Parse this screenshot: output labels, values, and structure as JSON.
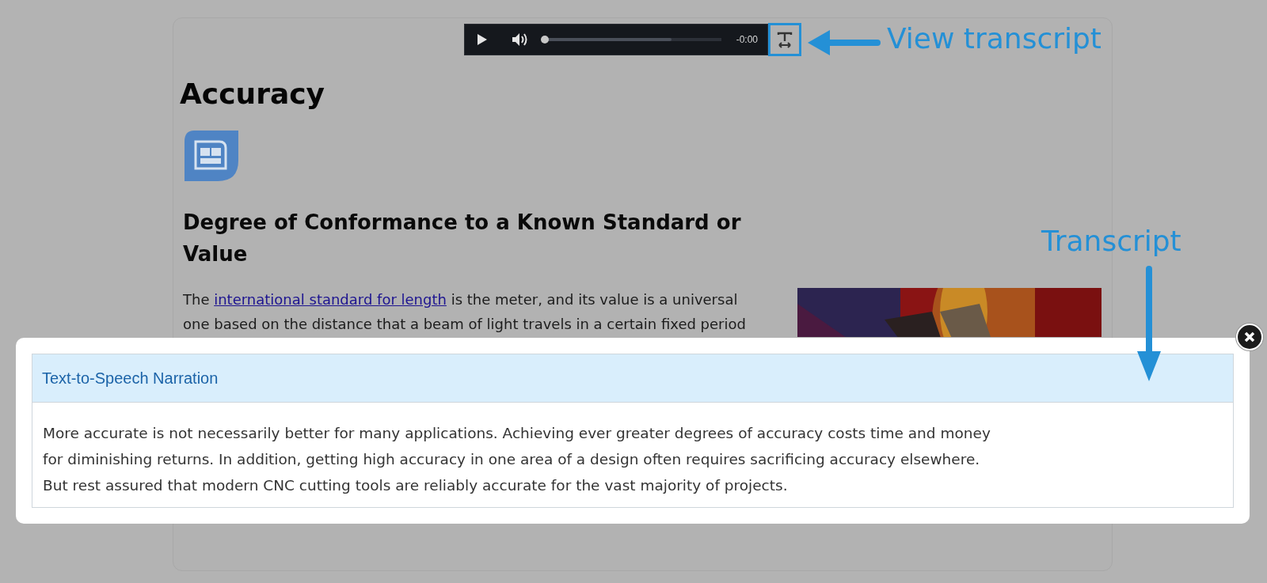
{
  "player": {
    "time": "-0:00",
    "progress": {
      "level": 0
    },
    "buffered": {
      "level": 0.72
    }
  },
  "page": {
    "title": "Accuracy",
    "subtitle": "Degree of Conformance to a Known Standard or Value",
    "paragraph": {
      "before": "The ",
      "link": "international standard for length",
      "after": " is the meter, and its value is a universal one based on the distance that a beam of light travels in a certain fixed period"
    }
  },
  "transcript": {
    "title": "Text-to-Speech Narration",
    "lines": [
      "More accurate is not necessarily better for many applications. Achieving ever greater degrees of accuracy costs time and money",
      "for diminishing returns. In addition, getting high accuracy in one area of a design often requires sacrificing accuracy elsewhere.",
      "But rest assured that modern CNC cutting tools are reliably accurate for the vast majority of projects."
    ]
  },
  "annotations": [
    {
      "label": "View transcript"
    },
    {
      "label": "Transcript"
    }
  ]
}
